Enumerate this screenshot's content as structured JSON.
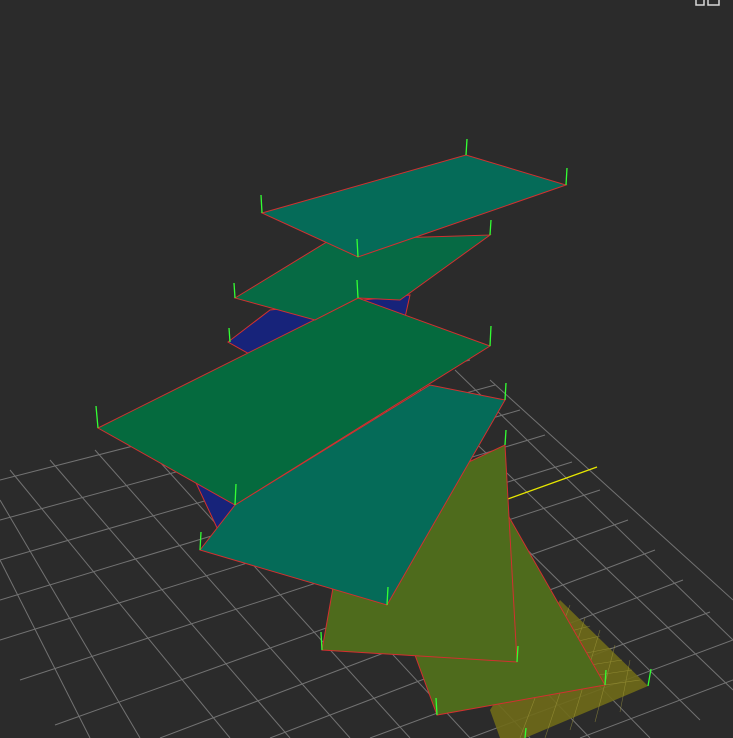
{
  "viewport": {
    "corner_label": "",
    "icon": "viewport-gizmo-icon"
  },
  "colors": {
    "background": "#2b2b2b",
    "grid": "#8a8a8a",
    "axis_x": "#e6e600",
    "plane_edge": "#d23030",
    "normal": "#33ff33",
    "plane_teal": "#056b58",
    "plane_green": "#056a3e",
    "plane_olive": "#4e6b1c",
    "plane_blue": "#17237a",
    "selected_grid": "#6f6a18"
  }
}
